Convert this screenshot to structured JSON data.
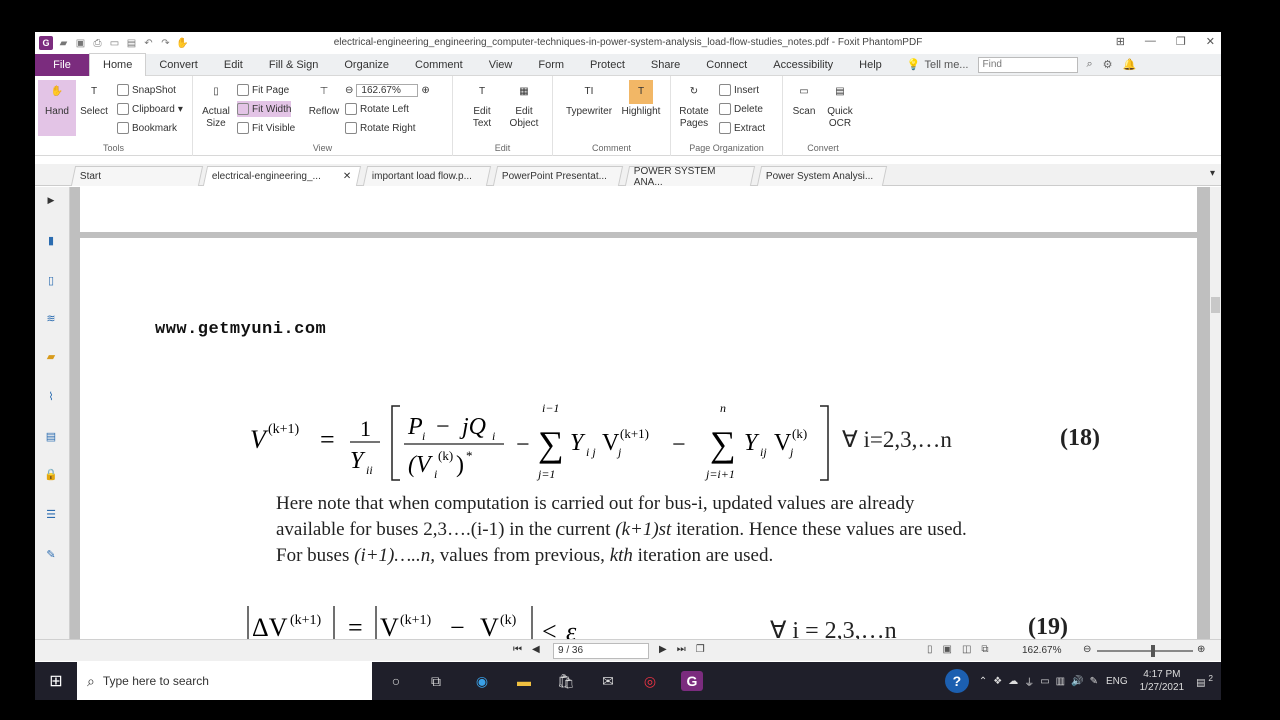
{
  "window": {
    "title": "electrical-engineering_engineering_computer-techniques-in-power-system-analysis_load-flow-studies_notes.pdf - Foxit PhantomPDF",
    "logo": "G"
  },
  "menu": {
    "file": "File",
    "tabs": [
      "Home",
      "Convert",
      "Edit",
      "Fill & Sign",
      "Organize",
      "Comment",
      "View",
      "Form",
      "Protect",
      "Share",
      "Connect",
      "Accessibility",
      "Help"
    ],
    "tell_me": "Tell me...",
    "find_placeholder": "Find"
  },
  "ribbon": {
    "tools": {
      "hand": "Hand",
      "select": "Select",
      "snapshot": "SnapShot",
      "clipboard": "Clipboard",
      "bookmark": "Bookmark",
      "label": "Tools"
    },
    "view": {
      "actual_size": "Actual Size",
      "fit_page": "Fit Page",
      "fit_width": "Fit Width",
      "fit_visible": "Fit Visible",
      "reflow": "Reflow",
      "zoom": "162.67%",
      "rotate_left": "Rotate Left",
      "rotate_right": "Rotate Right",
      "label": "View"
    },
    "edit": {
      "edit_text": "Edit Text",
      "edit_object": "Edit Object",
      "label": "Edit"
    },
    "comment": {
      "typewriter": "Typewriter",
      "highlight": "Highlight",
      "label": "Comment"
    },
    "page_org": {
      "rotate_pages": "Rotate Pages",
      "insert": "Insert",
      "delete": "Delete",
      "extract": "Extract",
      "label": "Page Organization"
    },
    "convert": {
      "scan": "Scan",
      "quick_ocr": "Quick OCR",
      "label": "Convert"
    }
  },
  "doc_tabs": [
    {
      "label": "Start"
    },
    {
      "label": "electrical-engineering_..."
    },
    {
      "label": "important load flow.p..."
    },
    {
      "label": "PowerPoint Presentat..."
    },
    {
      "label": "POWER SYSTEM ANA..."
    },
    {
      "label": "Power System Analysi..."
    }
  ],
  "page": {
    "url": "www.getmyuni.com",
    "eq18_number": "(18)",
    "eq18_forall": "∀ i=2,3,…n",
    "para_line1": "Here note that when computation is carried out for bus-i, updated values are already",
    "para_line2a": "available for buses 2,3….(i-1) in the current ",
    "para_line2b": "(k+1)st",
    "para_line2c": " iteration. Hence these values are used.",
    "para_line3a": "For buses ",
    "para_line3b": "(i+1)…..n,",
    "para_line3c": " values from previous, ",
    "para_line3d": "kth",
    "para_line3e": " iteration are used.",
    "eq19_forall": "∀ i = 2,3,…n",
    "eq19_number": "(19)"
  },
  "status": {
    "page": "9 / 36",
    "zoom": "162.67%"
  },
  "taskbar": {
    "search_placeholder": "Type here to search",
    "lang": "ENG",
    "time": "4:17 PM",
    "date": "1/27/2021",
    "notif": "2"
  },
  "colors": {
    "brand": "#7b2c7e",
    "taskbar": "#1f1f2a"
  }
}
